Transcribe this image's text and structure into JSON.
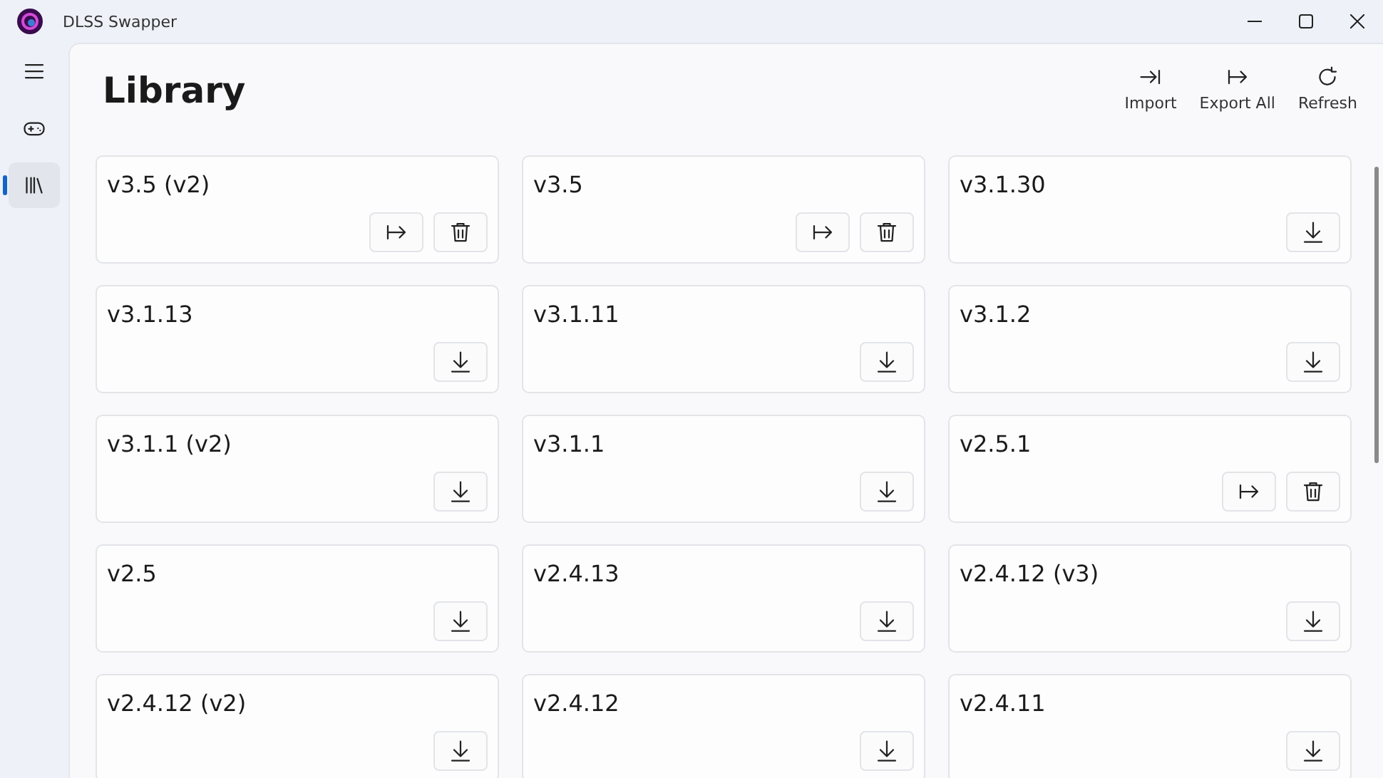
{
  "window": {
    "title": "DLSS Swapper"
  },
  "nav": [
    {
      "kind": "menu",
      "selected": false
    },
    {
      "kind": "games",
      "selected": false
    },
    {
      "kind": "library",
      "selected": true
    }
  ],
  "page": {
    "title": "Library"
  },
  "toolbar": [
    {
      "kind": "import",
      "label": "Import"
    },
    {
      "kind": "export",
      "label": "Export All"
    },
    {
      "kind": "refresh",
      "label": "Refresh"
    }
  ],
  "cards": [
    {
      "version": "v3.5 (v2)",
      "downloaded": true
    },
    {
      "version": "v3.5",
      "downloaded": true
    },
    {
      "version": "v3.1.30",
      "downloaded": false
    },
    {
      "version": "v3.1.13",
      "downloaded": false
    },
    {
      "version": "v3.1.11",
      "downloaded": false
    },
    {
      "version": "v3.1.2",
      "downloaded": false
    },
    {
      "version": "v3.1.1 (v2)",
      "downloaded": false
    },
    {
      "version": "v3.1.1",
      "downloaded": false
    },
    {
      "version": "v2.5.1",
      "downloaded": true
    },
    {
      "version": "v2.5",
      "downloaded": false
    },
    {
      "version": "v2.4.13",
      "downloaded": false
    },
    {
      "version": "v2.4.12 (v3)",
      "downloaded": false
    },
    {
      "version": "v2.4.12 (v2)",
      "downloaded": false
    },
    {
      "version": "v2.4.12",
      "downloaded": false
    },
    {
      "version": "v2.4.11",
      "downloaded": false
    }
  ]
}
